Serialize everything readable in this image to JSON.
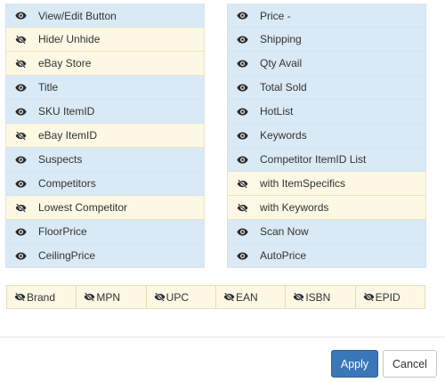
{
  "left_column": [
    {
      "label": "View/Edit Button",
      "state": "shown",
      "icon": "eye-icon"
    },
    {
      "label": "Hide/ Unhide",
      "state": "hidden",
      "icon": "eye-slash-icon"
    },
    {
      "label": "eBay Store",
      "state": "hidden",
      "icon": "eye-slash-icon"
    },
    {
      "label": "Title",
      "state": "shown",
      "icon": "eye-icon"
    },
    {
      "label": "SKU ItemID",
      "state": "shown",
      "icon": "eye-icon"
    },
    {
      "label": "eBay ItemID",
      "state": "hidden",
      "icon": "eye-slash-icon"
    },
    {
      "label": "Suspects",
      "state": "shown",
      "icon": "eye-icon"
    },
    {
      "label": "Competitors",
      "state": "shown",
      "icon": "eye-icon"
    },
    {
      "label": "Lowest Competitor",
      "state": "hidden",
      "icon": "eye-slash-icon"
    },
    {
      "label": "FloorPrice",
      "state": "shown",
      "icon": "eye-icon"
    },
    {
      "label": "CeilingPrice",
      "state": "shown",
      "icon": "eye-icon"
    }
  ],
  "right_column": [
    {
      "label": "Price -",
      "state": "shown",
      "icon": "eye-icon"
    },
    {
      "label": "Shipping",
      "state": "shown",
      "icon": "eye-icon"
    },
    {
      "label": "Qty Avail",
      "state": "shown",
      "icon": "eye-icon"
    },
    {
      "label": "Total Sold",
      "state": "shown",
      "icon": "eye-icon"
    },
    {
      "label": "HotList",
      "state": "shown",
      "icon": "eye-icon"
    },
    {
      "label": "Keywords",
      "state": "shown",
      "icon": "eye-icon"
    },
    {
      "label": "Competitor ItemID List",
      "state": "shown",
      "icon": "eye-icon"
    },
    {
      "label": "with ItemSpecifics",
      "state": "hidden",
      "icon": "eye-slash-icon"
    },
    {
      "label": "with Keywords",
      "state": "hidden",
      "icon": "eye-slash-icon"
    },
    {
      "label": "Scan Now",
      "state": "shown",
      "icon": "eye-icon"
    },
    {
      "label": "AutoPrice",
      "state": "shown",
      "icon": "eye-icon"
    }
  ],
  "identifier_bar": [
    {
      "label": "Brand",
      "state": "hidden",
      "icon": "eye-slash-icon"
    },
    {
      "label": "MPN",
      "state": "hidden",
      "icon": "eye-slash-icon"
    },
    {
      "label": "UPC",
      "state": "hidden",
      "icon": "eye-slash-icon"
    },
    {
      "label": "EAN",
      "state": "hidden",
      "icon": "eye-slash-icon"
    },
    {
      "label": "ISBN",
      "state": "hidden",
      "icon": "eye-slash-icon"
    },
    {
      "label": "EPID",
      "state": "hidden",
      "icon": "eye-slash-icon"
    }
  ],
  "footer": {
    "apply_label": "Apply",
    "cancel_label": "Cancel"
  },
  "colors": {
    "shown_row": "#d9eaf6",
    "hidden_row": "#fcf8e3",
    "primary_button": "#3a77b8"
  }
}
